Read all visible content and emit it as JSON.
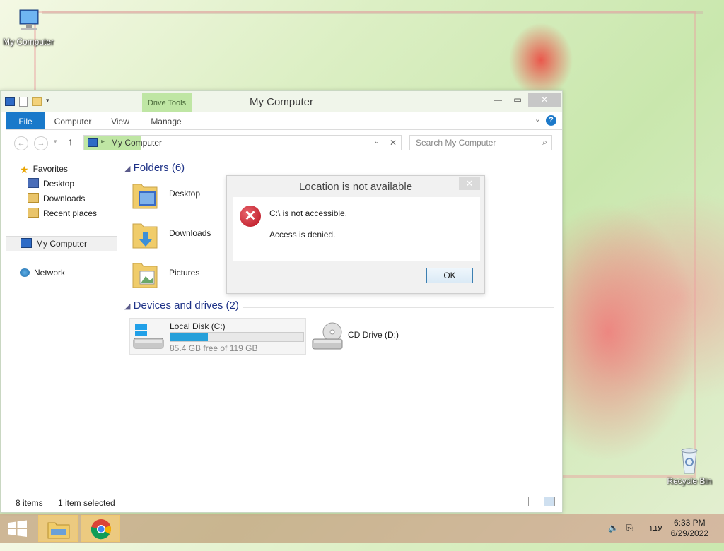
{
  "desktop": {
    "my_computer_label": "My Computer",
    "recycle_bin_label": "Recycle Bin"
  },
  "window": {
    "title": "My Computer",
    "context_tab": "Drive Tools",
    "ribbon_tabs": [
      "File",
      "Computer",
      "View",
      "Manage"
    ],
    "address": "My Computer",
    "search_placeholder": "Search My Computer",
    "status_items": "8 items",
    "status_selected": "1 item selected"
  },
  "nav": {
    "favorites": "Favorites",
    "desktop": "Desktop",
    "downloads": "Downloads",
    "recent": "Recent places",
    "my_computer": "My Computer",
    "network": "Network"
  },
  "content": {
    "folders_header": "Folders (6)",
    "folders": [
      "Desktop",
      "Downloads",
      "Pictures"
    ],
    "drives_header": "Devices and drives (2)",
    "drive_c": {
      "name": "Local Disk (C:)",
      "free_text": "85.4 GB free of 119 GB",
      "used_fraction": 0.28
    },
    "drive_d": {
      "name": "CD Drive (D:)"
    }
  },
  "dialog": {
    "title": "Location is not available",
    "line1": "C:\\ is not accessible.",
    "line2": "Access is denied.",
    "ok": "OK"
  },
  "taskbar": {
    "language": "עבר",
    "time": "6:33 PM",
    "date": "6/29/2022"
  },
  "colors": {
    "accent": "#1979ca",
    "context_green": "#bfe6a4",
    "error_red": "#c8202e"
  }
}
